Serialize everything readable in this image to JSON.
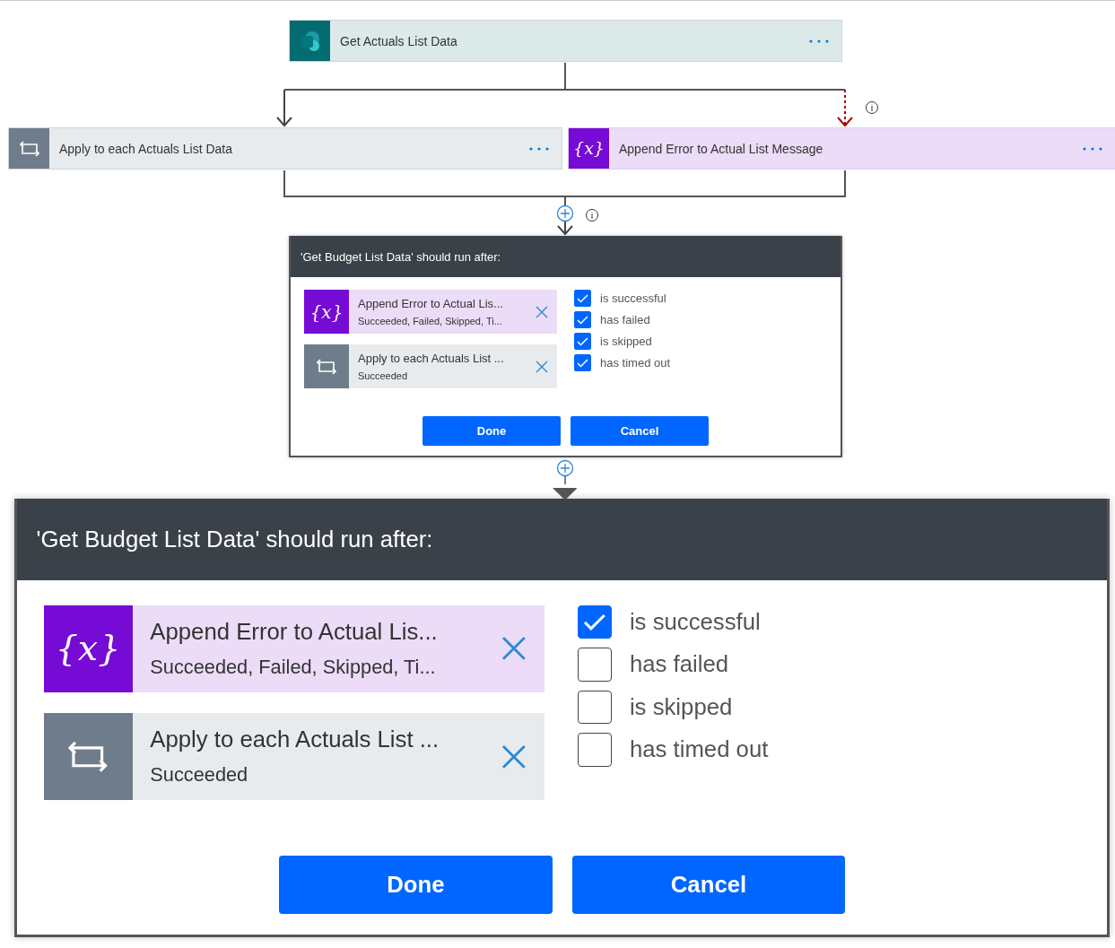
{
  "flow": {
    "nodes": [
      {
        "kind": "sharepoint",
        "title": "Get Actuals List Data"
      },
      {
        "kind": "loop",
        "title": "Apply to each Actuals List Data"
      },
      {
        "kind": "variable",
        "icon_text": "{x}",
        "title": "Append Error to Actual List Message"
      }
    ]
  },
  "dialogs": [
    {
      "kind": "compact",
      "title": "'Get Budget List Data' should run after:",
      "items": [
        {
          "kind": "variable",
          "icon_text": "{x}",
          "title": "Append Error to Actual Lis...",
          "subtitle": "Succeeded, Failed, Skipped, Ti..."
        },
        {
          "kind": "loop",
          "title": "Apply to each Actuals List ...",
          "subtitle": "Succeeded"
        }
      ],
      "conditions": [
        {
          "label": "is successful",
          "checked": true
        },
        {
          "label": "has failed",
          "checked": true
        },
        {
          "label": "is skipped",
          "checked": true
        },
        {
          "label": "has timed out",
          "checked": true
        }
      ],
      "buttons": [
        "Done",
        "Cancel"
      ]
    },
    {
      "kind": "expanded",
      "title": "'Get Budget List Data' should run after:",
      "items": [
        {
          "kind": "variable",
          "icon_text": "{x}",
          "title": "Append Error to Actual Lis...",
          "subtitle": "Succeeded, Failed, Skipped, Ti..."
        },
        {
          "kind": "loop",
          "title": "Apply to each Actuals List ...",
          "subtitle": "Succeeded"
        }
      ],
      "conditions": [
        {
          "label": "is successful",
          "checked": true
        },
        {
          "label": "has failed",
          "checked": false
        },
        {
          "label": "is skipped",
          "checked": false
        },
        {
          "label": "has timed out",
          "checked": false
        }
      ],
      "buttons": [
        "Done",
        "Cancel"
      ]
    }
  ]
}
